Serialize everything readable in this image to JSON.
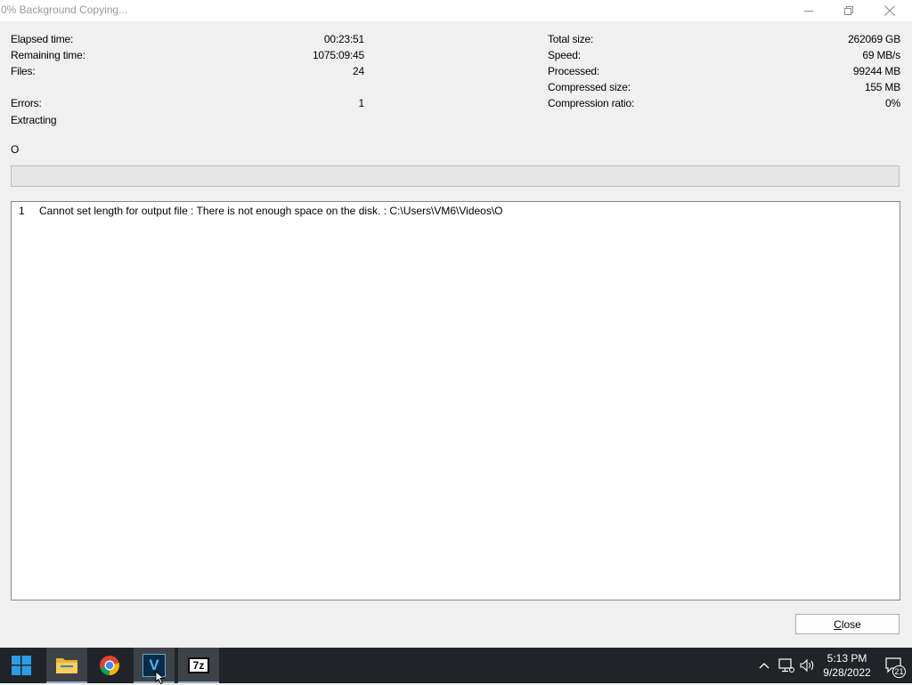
{
  "window": {
    "title": "0% Background Copying...",
    "controls": {
      "minimize": "minimize-icon",
      "restore": "restore-icon",
      "close": "close-icon"
    }
  },
  "stats_left": {
    "elapsed_label": "Elapsed time:",
    "elapsed_value": "00:23:51",
    "remaining_label": "Remaining time:",
    "remaining_value": "1075:09:45",
    "files_label": "Files:",
    "files_value": "24",
    "errors_label": "Errors:",
    "errors_value": "1",
    "status": "Extracting",
    "current_file": "O"
  },
  "stats_right": {
    "total_label": "Total size:",
    "total_value": "262069 GB",
    "speed_label": "Speed:",
    "speed_value": "69 MB/s",
    "processed_label": "Processed:",
    "processed_value": "99244 MB",
    "compressed_label": "Compressed size:",
    "compressed_value": "155 MB",
    "ratio_label": "Compression ratio:",
    "ratio_value": "0%"
  },
  "progress": {
    "percent": 0
  },
  "errors": [
    {
      "index": "1",
      "message": "Cannot set length for output file : There is not enough space on the disk. : C:\\Users\\VM6\\Videos\\O"
    }
  ],
  "buttons": {
    "close_underlined": "C",
    "close_rest": "lose"
  },
  "taskbar": {
    "icons": [
      "windows-start-icon",
      "file-explorer-icon",
      "chrome-icon",
      "veracrypt-icon",
      "7zip-icon"
    ],
    "veracrypt_letter": "V",
    "sevenzip_label": "7z",
    "time": "5:13 PM",
    "date": "9/28/2022",
    "notification_count": "21",
    "colors": {
      "taskbar_bg": "#202428",
      "active_bg": "#3d4247",
      "accent": "#8fa7c4"
    }
  }
}
